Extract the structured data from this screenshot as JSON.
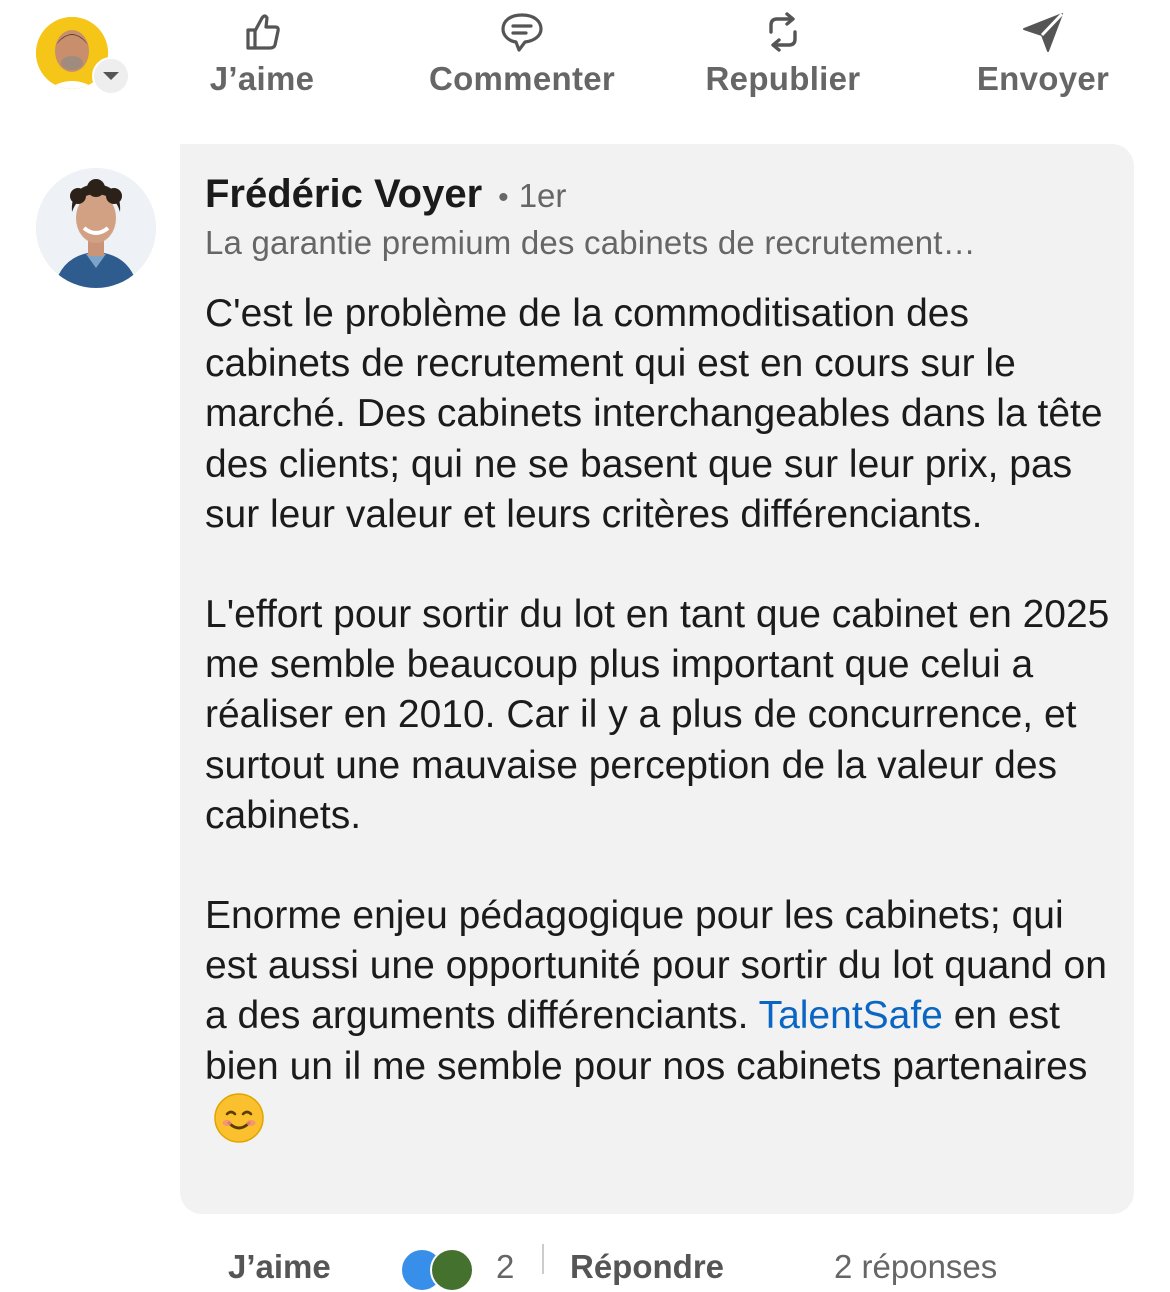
{
  "actions": {
    "like": "J’aime",
    "comment": "Commenter",
    "repost": "Republier",
    "send": "Envoyer"
  },
  "comment": {
    "author_name": "Frédéric Voyer",
    "separator": "•",
    "degree": "1er",
    "headline": "La garantie premium des cabinets de recrutement…",
    "paragraphs": [
      "C'est le problème de la commoditisation des cabinets de recrutement qui est en cours sur le marché. Des cabinets interchangeables dans la tête des clients; qui ne se basent que sur leur prix, pas sur leur valeur et leurs critères différenciants.",
      "L'effort pour sortir du lot en tant que cabinet en 2025 me semble beaucoup plus important que celui a réaliser en 2010. Car il y a plus de concurrence, et surtout une mauvaise perception de la valeur des cabinets.",
      "Enorme enjeu pédagogique pour les cabinets; qui est aussi une opportunité pour sortir du lot quand on a des arguments différenciants."
    ],
    "mention": "TalentSafe",
    "last_line_rest": " en est bien un il me semble pour nos cabinets partenaires",
    "emoji": "☺️"
  },
  "footer": {
    "like": "J’aime",
    "reaction_count": "2",
    "reply": "Répondre",
    "replies": "2 réponses"
  },
  "colors": {
    "accent_link": "#0a66c2",
    "bubble_bg": "#f2f2f2",
    "muted_text": "#666666",
    "primary_text": "#1b1b1b"
  },
  "icons": {
    "like": "thumbs-up-icon",
    "comment": "speech-bubble-icon",
    "repost": "repost-arrows-icon",
    "send": "paper-plane-icon",
    "caret": "caret-down-icon"
  }
}
